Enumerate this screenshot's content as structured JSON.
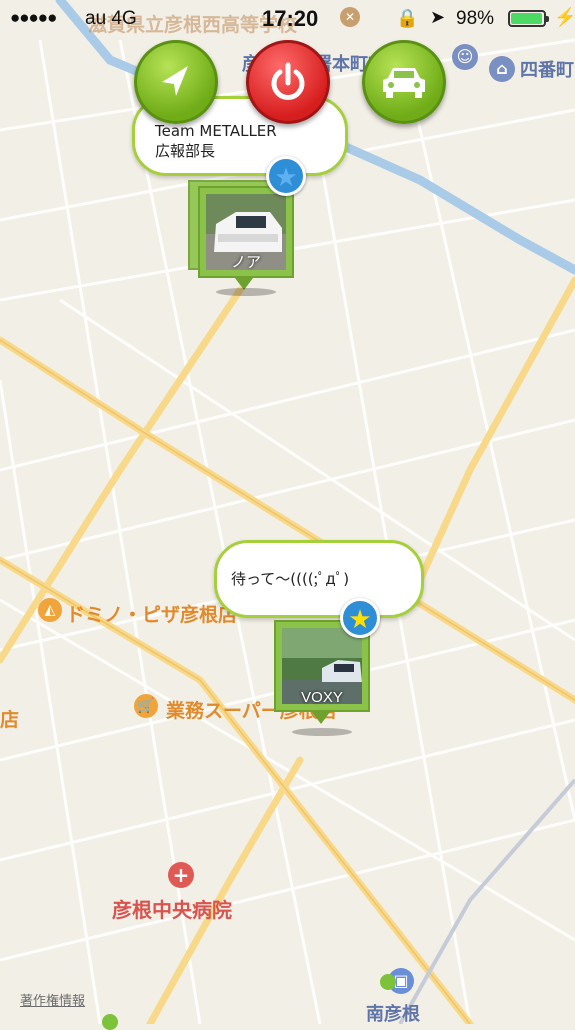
{
  "status_bar": {
    "signal_dots": "●●●●●",
    "carrier": "au 4G",
    "time": "17:20",
    "battery_percent": "98%",
    "lock_icon": "rotation-lock-icon",
    "location_icon": "location-arrow-icon",
    "charging_icon": "bolt-icon"
  },
  "map_labels": {
    "school": "滋賀県立彦根西高等学校",
    "police": "彦根警察署本町交番",
    "shibancho": "四番町",
    "pizza": "ドミノ・ピザ彦根店",
    "gyomu": "業務スーパー彦根店",
    "left_partial": "店",
    "hospital": "彦根中央病院",
    "station": "南彦根",
    "copyright": "著作権情報"
  },
  "controls": {
    "navigate_icon": "navigation-arrow-icon",
    "power_icon": "power-icon",
    "car_icon": "car-icon"
  },
  "pins": [
    {
      "bubble_lines": [
        "Team METALLER",
        "広報部長"
      ],
      "caption": "ノア",
      "favorite_icon": "star-icon"
    },
    {
      "bubble_lines": [
        "待って〜((((;ﾟдﾟ)"
      ],
      "caption": "VOXY",
      "favorite_icon": "star-icon"
    }
  ],
  "colors": {
    "map_background": "#f2efe6",
    "accent_green": "#8bc34a",
    "power_red": "#d71e1e",
    "star_blue": "#2f8fd6",
    "star_yellow": "#ffe000",
    "water": "#a9cbe8",
    "road_major": "#f8d98a"
  }
}
